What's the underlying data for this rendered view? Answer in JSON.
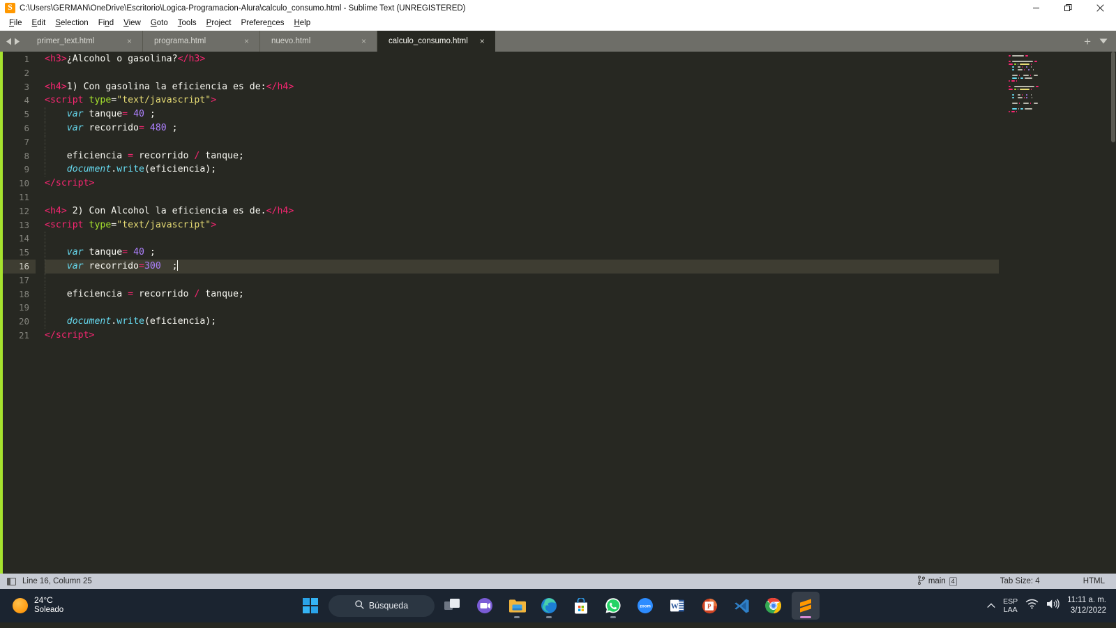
{
  "window": {
    "title": "C:\\Users\\GERMAN\\OneDrive\\Escritorio\\Logica-Programacion-Alura\\calculo_consumo.html - Sublime Text (UNREGISTERED)",
    "logo_icon": "sublime-text-logo-icon",
    "controls": {
      "minimize": "minimize-icon",
      "maximize": "restore-icon",
      "close": "close-icon"
    }
  },
  "menubar": {
    "items": [
      {
        "label": "File"
      },
      {
        "label": "Edit"
      },
      {
        "label": "Selection"
      },
      {
        "label": "Find"
      },
      {
        "label": "View"
      },
      {
        "label": "Goto"
      },
      {
        "label": "Tools"
      },
      {
        "label": "Project"
      },
      {
        "label": "Preferences"
      },
      {
        "label": "Help"
      }
    ]
  },
  "tabbar": {
    "nav_prev_icon": "chevron-left-icon",
    "nav_next_icon": "chevron-right-icon",
    "close_glyph": "×",
    "new_tab_label": "+",
    "tab_menu_icon": "chevron-down-icon",
    "tabs": [
      {
        "label": "primer_text.html",
        "active": false
      },
      {
        "label": "programa.html",
        "active": false
      },
      {
        "label": "nuevo.html",
        "active": false
      },
      {
        "label": "calculo_consumo.html",
        "active": true
      }
    ]
  },
  "editor": {
    "active_line": 16,
    "accent_color": "#a6e22e",
    "background": "#272822",
    "active_line_background": "#3e3d32",
    "lines": [
      {
        "n": 1,
        "tokens": [
          {
            "t": "tag",
            "v": "<h3>"
          },
          {
            "t": "plain",
            "v": "¿Alcohol o gasolina?"
          },
          {
            "t": "tag",
            "v": "</h3>"
          }
        ]
      },
      {
        "n": 2,
        "tokens": []
      },
      {
        "n": 3,
        "tokens": [
          {
            "t": "tag",
            "v": "<h4>"
          },
          {
            "t": "plain",
            "v": "1) Con gasolina la eficiencia es de:"
          },
          {
            "t": "tag",
            "v": "</h4>"
          }
        ]
      },
      {
        "n": 4,
        "tokens": [
          {
            "t": "tag",
            "v": "<script "
          },
          {
            "t": "attr",
            "v": "type"
          },
          {
            "t": "plain",
            "v": "="
          },
          {
            "t": "string",
            "v": "\"text/javascript\""
          },
          {
            "t": "tag",
            "v": ">"
          }
        ]
      },
      {
        "n": 5,
        "tokens": [
          {
            "t": "plain",
            "v": "    "
          },
          {
            "t": "kw",
            "v": "var"
          },
          {
            "t": "plain",
            "v": " tanque"
          },
          {
            "t": "op",
            "v": "="
          },
          {
            "t": "plain",
            "v": " "
          },
          {
            "t": "num",
            "v": "40"
          },
          {
            "t": "plain",
            "v": " ;"
          }
        ]
      },
      {
        "n": 6,
        "tokens": [
          {
            "t": "plain",
            "v": "    "
          },
          {
            "t": "kw",
            "v": "var"
          },
          {
            "t": "plain",
            "v": " recorrido"
          },
          {
            "t": "op",
            "v": "="
          },
          {
            "t": "plain",
            "v": " "
          },
          {
            "t": "num",
            "v": "480"
          },
          {
            "t": "plain",
            "v": " ;"
          }
        ]
      },
      {
        "n": 7,
        "tokens": []
      },
      {
        "n": 8,
        "tokens": [
          {
            "t": "plain",
            "v": "    eficiencia "
          },
          {
            "t": "op",
            "v": "="
          },
          {
            "t": "plain",
            "v": " recorrido "
          },
          {
            "t": "op",
            "v": "/"
          },
          {
            "t": "plain",
            "v": " tanque;"
          }
        ]
      },
      {
        "n": 9,
        "tokens": [
          {
            "t": "plain",
            "v": "    "
          },
          {
            "t": "kw",
            "v": "document"
          },
          {
            "t": "plain",
            "v": "."
          },
          {
            "t": "fn",
            "v": "write"
          },
          {
            "t": "plain",
            "v": "(eficiencia);"
          }
        ]
      },
      {
        "n": 10,
        "tokens": [
          {
            "t": "tag",
            "v": "</"
          },
          {
            "t": "tag2",
            "v": "script"
          },
          {
            "t": "tag",
            "v": ">"
          }
        ]
      },
      {
        "n": 11,
        "tokens": []
      },
      {
        "n": 12,
        "tokens": [
          {
            "t": "tag",
            "v": "<h4>"
          },
          {
            "t": "plain",
            "v": " 2) Con Alcohol la eficiencia es de."
          },
          {
            "t": "tag",
            "v": "</h4>"
          }
        ]
      },
      {
        "n": 13,
        "tokens": [
          {
            "t": "tag",
            "v": "<script "
          },
          {
            "t": "attr",
            "v": "type"
          },
          {
            "t": "plain",
            "v": "="
          },
          {
            "t": "string",
            "v": "\"text/javascript\""
          },
          {
            "t": "tag",
            "v": ">"
          }
        ]
      },
      {
        "n": 14,
        "tokens": []
      },
      {
        "n": 15,
        "tokens": [
          {
            "t": "plain",
            "v": "    "
          },
          {
            "t": "kw",
            "v": "var"
          },
          {
            "t": "plain",
            "v": " tanque"
          },
          {
            "t": "op",
            "v": "="
          },
          {
            "t": "plain",
            "v": " "
          },
          {
            "t": "num",
            "v": "40"
          },
          {
            "t": "plain",
            "v": " ;"
          }
        ]
      },
      {
        "n": 16,
        "tokens": [
          {
            "t": "plain",
            "v": "    "
          },
          {
            "t": "kw",
            "v": "var"
          },
          {
            "t": "plain",
            "v": " recorrido"
          },
          {
            "t": "op",
            "v": "="
          },
          {
            "t": "num",
            "v": "300"
          },
          {
            "t": "plain",
            "v": "  ;"
          },
          {
            "t": "caret",
            "v": ""
          }
        ]
      },
      {
        "n": 17,
        "tokens": []
      },
      {
        "n": 18,
        "tokens": [
          {
            "t": "plain",
            "v": "    eficiencia "
          },
          {
            "t": "op",
            "v": "="
          },
          {
            "t": "plain",
            "v": " recorrido "
          },
          {
            "t": "op",
            "v": "/"
          },
          {
            "t": "plain",
            "v": " tanque;"
          }
        ]
      },
      {
        "n": 19,
        "tokens": []
      },
      {
        "n": 20,
        "tokens": [
          {
            "t": "plain",
            "v": "    "
          },
          {
            "t": "kw",
            "v": "document"
          },
          {
            "t": "plain",
            "v": "."
          },
          {
            "t": "fn",
            "v": "write"
          },
          {
            "t": "plain",
            "v": "(eficiencia);"
          }
        ]
      },
      {
        "n": 21,
        "tokens": [
          {
            "t": "tag",
            "v": "</"
          },
          {
            "t": "tag2",
            "v": "script"
          },
          {
            "t": "tag",
            "v": ">"
          }
        ]
      }
    ]
  },
  "statusbar": {
    "sidebar_toggle_icon": "sidebar-toggle-icon",
    "cursor_position": "Line 16, Column 25",
    "branch_icon": "git-branch-icon",
    "branch": "main",
    "branch_count": "4",
    "tab_size": "Tab Size: 4",
    "syntax": "HTML"
  },
  "taskbar": {
    "weather": {
      "icon": "sun-icon",
      "temperature": "24°C",
      "condition": "Soleado"
    },
    "start_icon": "windows-start-icon",
    "search": {
      "icon": "search-icon",
      "label": "Búsqueda"
    },
    "apps": [
      {
        "name": "task-view-icon",
        "label": "Vista de tareas",
        "running": false,
        "active": false
      },
      {
        "name": "microsoft-teams-icon",
        "label": "Microsoft Teams",
        "running": false,
        "active": false
      },
      {
        "name": "file-explorer-icon",
        "label": "Explorador de archivos",
        "running": true,
        "active": false
      },
      {
        "name": "microsoft-edge-icon",
        "label": "Microsoft Edge",
        "running": true,
        "active": false
      },
      {
        "name": "microsoft-store-icon",
        "label": "Microsoft Store",
        "running": false,
        "active": false
      },
      {
        "name": "whatsapp-icon",
        "label": "WhatsApp",
        "running": true,
        "active": false
      },
      {
        "name": "zoom-icon",
        "label": "Zoom",
        "running": false,
        "active": false
      },
      {
        "name": "microsoft-word-icon",
        "label": "Word",
        "running": false,
        "active": false
      },
      {
        "name": "microsoft-powerpoint-icon",
        "label": "PowerPoint",
        "running": false,
        "active": false
      },
      {
        "name": "visual-studio-code-icon",
        "label": "Visual Studio Code",
        "running": false,
        "active": false
      },
      {
        "name": "google-chrome-icon",
        "label": "Google Chrome",
        "running": false,
        "active": false
      },
      {
        "name": "sublime-text-icon",
        "label": "Sublime Text",
        "running": true,
        "active": true
      }
    ],
    "tray": {
      "overflow_icon": "chevron-up-icon",
      "language_top": "ESP",
      "language_bottom": "LAA",
      "wifi_icon": "wifi-icon",
      "volume_icon": "speaker-icon",
      "time": "11:11 a. m.",
      "date": "3/12/2022"
    }
  }
}
